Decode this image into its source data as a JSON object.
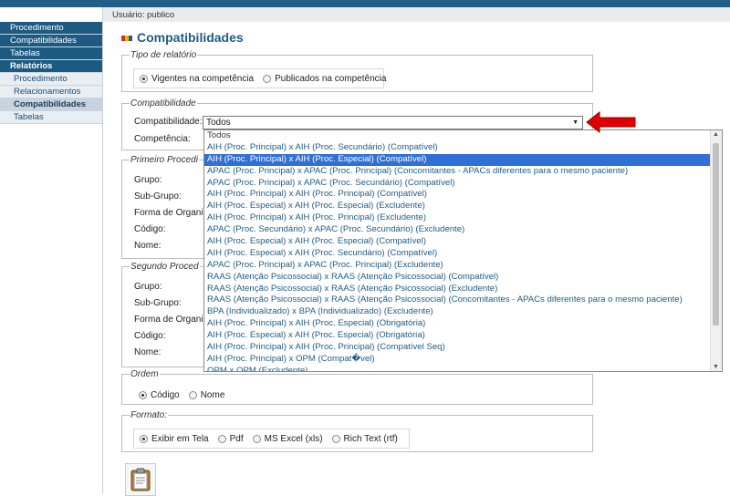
{
  "nav": {
    "items": [
      {
        "label": "Procedimento",
        "kind": "top"
      },
      {
        "label": "Compatibilidades",
        "kind": "top"
      },
      {
        "label": "Tabelas",
        "kind": "top"
      },
      {
        "label": "Relatórios",
        "kind": "top-active"
      },
      {
        "label": "Procedimento",
        "kind": "sub"
      },
      {
        "label": "Relacionamentos",
        "kind": "sub"
      },
      {
        "label": "Compatibilidades",
        "kind": "sub-active"
      },
      {
        "label": "Tabelas",
        "kind": "sub"
      }
    ]
  },
  "header": {
    "user_text": "Usuário: publico"
  },
  "page": {
    "title": "Compatibilidades"
  },
  "tipo_relatorio": {
    "legend": "Tipo de relatório",
    "options": [
      {
        "label": "Vigentes na competência",
        "checked": true
      },
      {
        "label": "Publicados na competência",
        "checked": false
      }
    ]
  },
  "compatibilidade": {
    "legend": "Compatibilidade",
    "label": "Compatibilidade:",
    "selected": "Todos",
    "competencia_label": "Competência:",
    "highlighted_index": 2,
    "options": [
      "Todos",
      "AIH (Proc. Principal) x AIH (Proc. Secundário) (Compatível)",
      "AIH (Proc. Principal) x AIH (Proc. Especial) (Compatível)",
      "APAC (Proc. Principal) x APAC (Proc. Principal) (Concomitantes - APACs diferentes para o mesmo paciente)",
      "APAC (Proc. Principal) x APAC (Proc. Secundário) (Compatível)",
      "AIH (Proc. Principal) x AIH (Proc. Principal) (Compatível)",
      "AIH (Proc. Especial) x AIH (Proc. Especial) (Excludente)",
      "AIH (Proc. Principal) x AIH (Proc. Principal) (Excludente)",
      "APAC (Proc. Secundário) x APAC (Proc. Secundário) (Excludente)",
      "AIH (Proc. Especial) x AIH (Proc. Especial) (Compatível)",
      "AIH (Proc. Especial) x AIH (Proc. Secundário) (Compatível)",
      "APAC (Proc. Principal) x APAC (Proc. Principal) (Excludente)",
      "RAAS (Atenção Psicossocial) x RAAS (Atenção Psicossocial) (Compatível)",
      "RAAS (Atenção Psicossocial) x RAAS (Atenção Psicossocial) (Excludente)",
      "RAAS (Atenção Psicossocial) x RAAS (Atenção Psicossocial) (Concomitantes - APACs diferentes para o mesmo paciente)",
      "BPA (Individualizado) x BPA (Individualizado) (Excludente)",
      "AIH (Proc. Principal) x AIH (Proc. Especial) (Obrigatória)",
      "AIH (Proc. Especial) x AIH (Proc. Especial) (Obrigatória)",
      "AIH (Proc. Principal) x AIH (Proc. Principal) (Compatível Seq)",
      "AIH (Proc. Principal) x OPM (Compat�vel)",
      "OPM x OPM (Excludente)"
    ]
  },
  "primeiro": {
    "legend": "Primeiro Procedi",
    "fields": [
      "Grupo:",
      "Sub-Grupo:",
      "Forma de Organiz",
      "Código:",
      "Nome:"
    ]
  },
  "segundo": {
    "legend": "Segundo Proced",
    "fields": [
      "Grupo:",
      "Sub-Grupo:",
      "Forma de Organiz",
      "Código:",
      "Nome:"
    ]
  },
  "ordem": {
    "legend": "Ordem",
    "options": [
      {
        "label": "Código",
        "checked": true
      },
      {
        "label": "Nome",
        "checked": false
      }
    ]
  },
  "formato": {
    "legend": "Formato:",
    "options": [
      {
        "label": "Exibir em Tela",
        "checked": true
      },
      {
        "label": "Pdf",
        "checked": false
      },
      {
        "label": "MS Excel (xls)",
        "checked": false
      },
      {
        "label": "Rich Text (rtf)",
        "checked": false
      }
    ]
  },
  "actions": {
    "icon": "clipboard-icon"
  },
  "colors": {
    "nav_bg": "#1d5a82",
    "title": "#1f5c86",
    "selected_option": "#2f6fd6",
    "arrow": "#e00000"
  }
}
